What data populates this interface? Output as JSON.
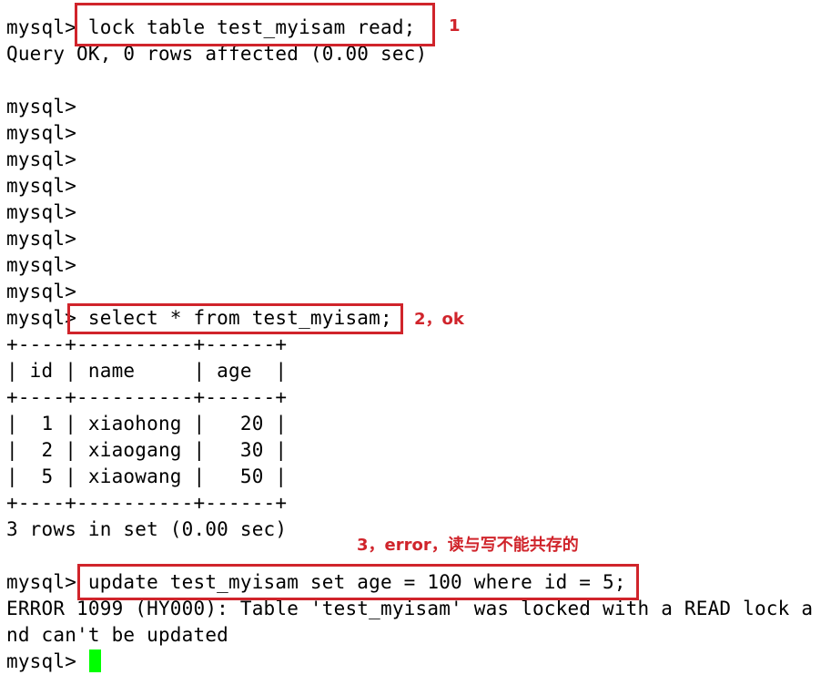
{
  "terminal": {
    "lines": [
      "mysql> lock table test_myisam read;",
      "Query OK, 0 rows affected (0.00 sec)",
      "",
      "mysql>",
      "mysql>",
      "mysql>",
      "mysql>",
      "mysql>",
      "mysql>",
      "mysql>",
      "mysql>",
      "mysql> select * from test_myisam;",
      "+----+----------+------+",
      "| id | name     | age  |",
      "+----+----------+------+",
      "|  1 | xiaohong |   20 |",
      "|  2 | xiaogang |   30 |",
      "|  5 | xiaowang |   50 |",
      "+----+----------+------+",
      "3 rows in set (0.00 sec)",
      "",
      "mysql> update test_myisam set age = 100 where id = 5;",
      "ERROR 1099 (HY000): Table 'test_myisam' was locked with a READ lock a",
      "nd can't be updated",
      "mysql> "
    ]
  },
  "annotations": {
    "note1": "1",
    "note2": "2，ok",
    "note3": "3，error，读与写不能共存的"
  },
  "colors": {
    "highlight_red": "#d0242b",
    "cursor_green": "#00ff00"
  }
}
